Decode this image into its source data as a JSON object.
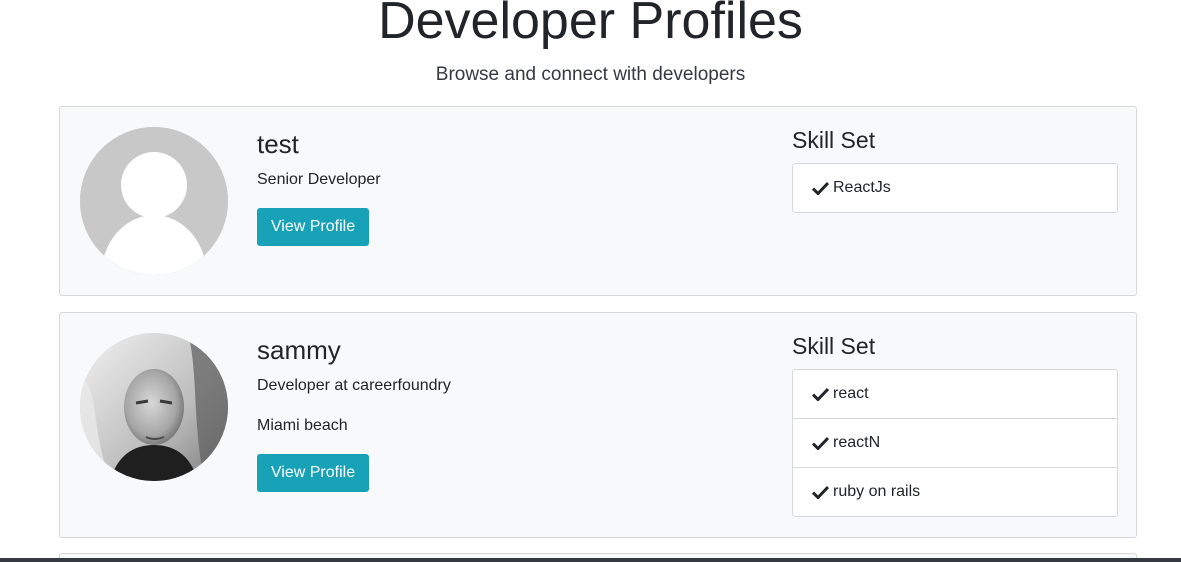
{
  "header": {
    "title": "Developer Profiles",
    "lead": "Browse and connect with developers"
  },
  "profiles": [
    {
      "name": "test",
      "status": "Senior Developer",
      "location": "",
      "avatar": "default-avatar-icon",
      "button_label": "View Profile",
      "skills_title": "Skill Set",
      "skills": [
        "ReactJs"
      ]
    },
    {
      "name": "sammy",
      "status": "Developer at careerfoundry",
      "location": "Miami beach",
      "avatar": "user-photo",
      "button_label": "View Profile",
      "skills_title": "Skill Set",
      "skills": [
        "react",
        "reactN",
        "ruby on rails"
      ]
    }
  ],
  "colors": {
    "button": "#17a2b8",
    "card_background": "#f8f9fa",
    "avatar_placeholder": "#c8c8c8"
  }
}
